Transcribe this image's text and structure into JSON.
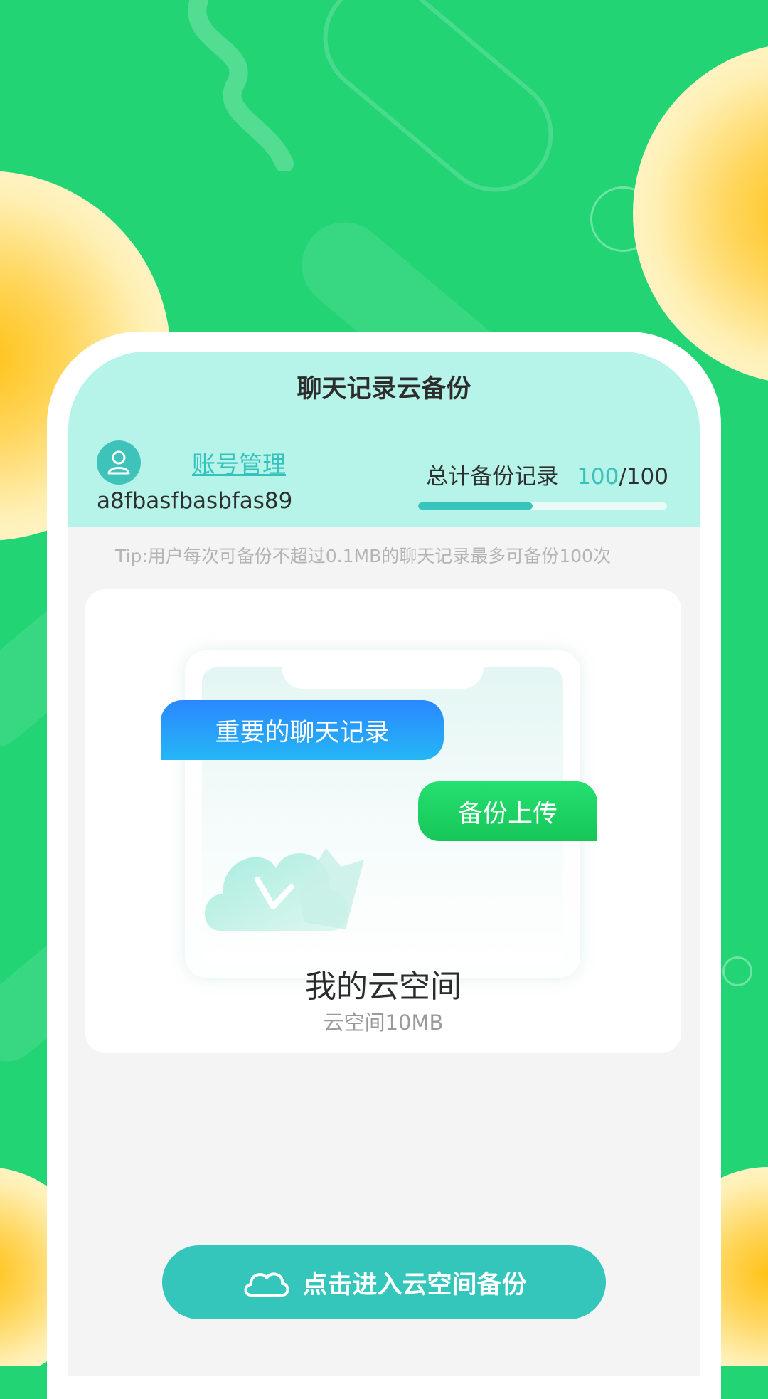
{
  "header": {
    "title": "聊天记录云备份"
  },
  "account": {
    "avatar_icon": "user-icon",
    "manage_link": "账号管理",
    "user_id": "a8fbasfbasbfas89"
  },
  "backup_stats": {
    "label": "总计备份记录",
    "used": "100",
    "separator": "/",
    "total": "100",
    "progress_fraction": 0.46
  },
  "tip": "Tip:用户每次可备份不超过0.1MB的聊天记录最多可备份100次",
  "cloud_card": {
    "bubble_chat": "重要的聊天记录",
    "bubble_upload": "备份上传",
    "cloud_icon": "cloud-download-icon",
    "title": "我的云空间",
    "subtitle": "云空间10MB"
  },
  "cta": {
    "icon": "cloud-icon",
    "label": "点击进入云空间备份"
  },
  "colors": {
    "background": "#22d474",
    "header_band": "#b6f3e9",
    "accent_teal": "#35c2bd",
    "bubble_blue": "#2a88ff",
    "bubble_green": "#1cd263",
    "button": "#34c5bb"
  }
}
